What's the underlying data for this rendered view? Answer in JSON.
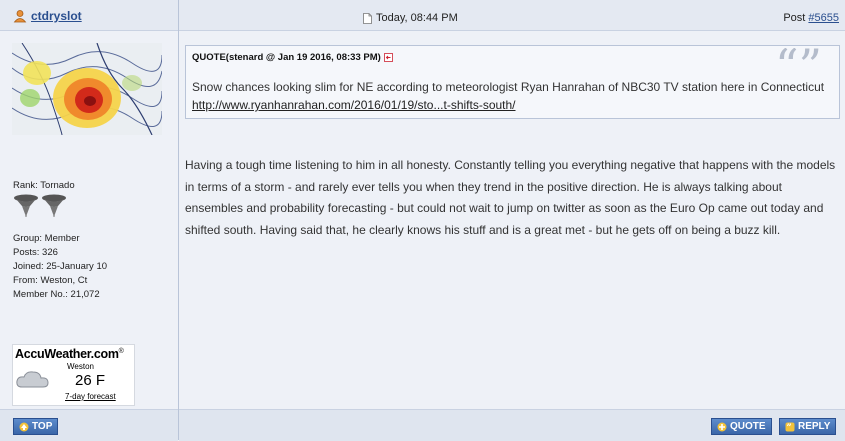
{
  "user": {
    "name": "ctdryslot",
    "rank_label": "Rank: Tornado",
    "details": [
      "Group: Member",
      "Posts: 326",
      "Joined: 25-January 10",
      "From: Weston, Ct",
      "Member No.: 21,072"
    ]
  },
  "post": {
    "date": "Today, 08:44 PM",
    "number_prefix": "Post ",
    "number": "#5655",
    "quote": {
      "header": "QUOTE(stenard @ Jan 19 2016, 08:33 PM)",
      "text": "Snow chances looking slim for NE according to meteorologist Ryan Hanrahan of NBC30 TV station here in Connecticut",
      "url": "http://www.ryanhanrahan.com/2016/01/19/sto...t-shifts-south/"
    },
    "body": "Having a tough time listening to him in all honesty. Constantly telling you everything negative that happens with the models in terms of a storm - and rarely ever tells you when they trend in the positive direction. He is always talking about ensembles and probability forecasting - but could not wait to jump on twitter as soon as the Euro Op came out today and shifted south. Having said that, he clearly knows his stuff and is a great met - but he gets off on being a buzz kill."
  },
  "weather": {
    "brand": "AccuWeather",
    "brand_suffix": ".com",
    "brand_sup": "®",
    "city": "Weston",
    "temp": "26 F",
    "link": "7-day forecast"
  },
  "buttons": {
    "top": "TOP",
    "quote": "QUOTE",
    "reply": "REPLY"
  },
  "colors": {
    "accent": "#2a4f8f",
    "button": "#4a78ba",
    "background": "#eef1f7"
  }
}
